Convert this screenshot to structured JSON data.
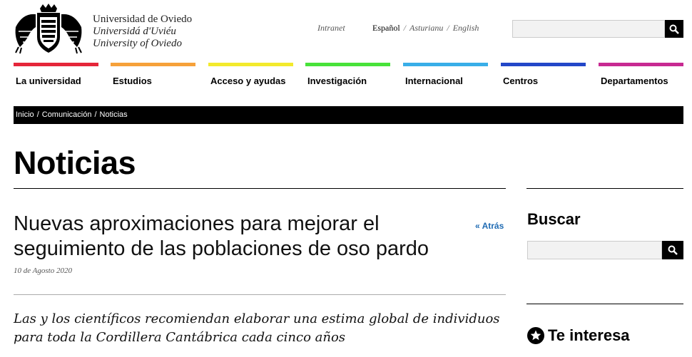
{
  "header": {
    "names": [
      "Universidad de Oviedo",
      "Universidá d'Uviéu",
      "University of Oviedo"
    ],
    "intranet": "Intranet",
    "languages": {
      "active": "Español",
      "others": [
        "Asturianu",
        "English"
      ],
      "separator": "/"
    },
    "search": {
      "value": "",
      "placeholder": ""
    }
  },
  "nav": [
    {
      "label": "La universidad",
      "color": "#e5263a"
    },
    {
      "label": "Estudios",
      "color": "#f6a13a"
    },
    {
      "label": "Acceso y ayudas",
      "color": "#f3ea2c"
    },
    {
      "label": "Investigación",
      "color": "#48e23a"
    },
    {
      "label": "Internacional",
      "color": "#39aee8"
    },
    {
      "label": "Centros",
      "color": "#2347c8"
    },
    {
      "label": "Departamentos",
      "color": "#c72a92"
    }
  ],
  "breadcrumb": {
    "items": [
      "Inicio",
      "Comunicación",
      "Noticias"
    ],
    "separator": "/"
  },
  "page": {
    "title": "Noticias"
  },
  "article": {
    "title": "Nuevas aproximaciones para mejorar el seguimiento de las poblaciones de oso pardo",
    "back": "« Atrás",
    "date": "10 de Agosto 2020",
    "lead": "Las y los científicos recomiendan elaborar una estima global de individuos para toda la Cordillera Cantábrica cada cinco años"
  },
  "sidebar": {
    "search_title": "Buscar",
    "search": {
      "value": "",
      "placeholder": ""
    },
    "interest_title": "Te interesa"
  },
  "colors": {
    "accent_link": "#1f6bb3",
    "breadcrumb_bg": "#000000"
  },
  "icons": {
    "logo": "university-shield-logo",
    "search": "search-icon",
    "interest": "star-icon"
  }
}
